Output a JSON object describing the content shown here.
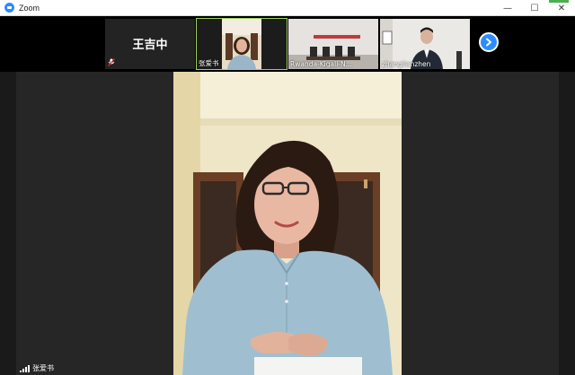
{
  "window": {
    "title": "Zoom",
    "controls": {
      "minimize": "—",
      "maximize": "☐",
      "close": "✕"
    }
  },
  "gallery": {
    "tiles": [
      {
        "name": "王吉中",
        "video": false,
        "muted": true
      },
      {
        "name": "张爱书",
        "video": true,
        "active": true
      },
      {
        "name": "Rwanda-Kigali-N...",
        "video": true
      },
      {
        "name": "zhanglianzhen",
        "video": true
      }
    ],
    "next_label": "›"
  },
  "speaker": {
    "name": "张爱书"
  },
  "colors": {
    "accent": "#2d8cff",
    "active_border": "#9bd356",
    "background": "#1a1a1a"
  }
}
